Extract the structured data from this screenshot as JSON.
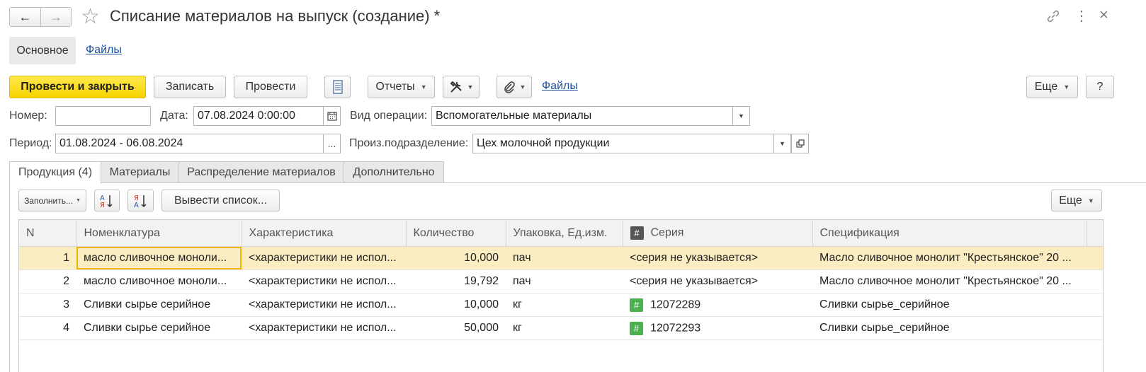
{
  "window": {
    "title": "Списание материалов на выпуск (создание) *",
    "back_icon": "←",
    "forward_icon": "→",
    "star_icon": "☆",
    "link_icon": "🔗",
    "menu_icon": "⋮",
    "close_icon": "×"
  },
  "nav_tabs": {
    "main": "Основное",
    "files": "Файлы"
  },
  "toolbar": {
    "post_close": "Провести и закрыть",
    "save": "Записать",
    "post": "Провести",
    "reports": "Отчеты",
    "files": "Файлы",
    "more": "Еще",
    "help": "?"
  },
  "form": {
    "number_label": "Номер:",
    "number_value": "",
    "date_label": "Дата:",
    "date_value": "07.08.2024  0:00:00",
    "operation_label": "Вид операции:",
    "operation_value": "Вспомогательные материалы",
    "period_label": "Период:",
    "period_value": "01.08.2024 - 06.08.2024",
    "period_btn": "...",
    "division_label": "Произ.подразделение:",
    "division_value": "Цех молочной продукции"
  },
  "tabs": [
    "Продукция (4)",
    "Материалы",
    "Распределение материалов",
    "Дополнительно"
  ],
  "table_toolbar": {
    "fill": "Заполнить...",
    "show_list": "Вывести список...",
    "more": "Еще",
    "sort_asc_glyph": "А\nЯ",
    "sort_desc_glyph": "Я\nА"
  },
  "table": {
    "columns": [
      "N",
      "Номенклатура",
      "Характеристика",
      "Количество",
      "Упаковка, Ед.изм.",
      "Серия",
      "Спецификация"
    ],
    "rows": [
      {
        "n": "1",
        "item": "масло сливочное моноли...",
        "char": "<характеристики не испол...",
        "qty": "10,000",
        "unit": "пач",
        "series": "<серия не указывается>",
        "series_muted": true,
        "spec": "Масло сливочное монолит \"Крестьянское\" 20 ..."
      },
      {
        "n": "2",
        "item": "масло сливочное моноли...",
        "char": "<характеристики не испол...",
        "qty": "19,792",
        "unit": "пач",
        "series": "<серия не указывается>",
        "series_muted": true,
        "spec": "Масло сливочное монолит \"Крестьянское\" 20 ..."
      },
      {
        "n": "3",
        "item": "Сливки сырье серийное",
        "char": "<характеристики не испол...",
        "qty": "10,000",
        "unit": "кг",
        "series": "12072289",
        "series_muted": false,
        "spec": "Сливки сырье_серийное"
      },
      {
        "n": "4",
        "item": "Сливки сырье серийное",
        "char": "<характеристики не испол...",
        "qty": "50,000",
        "unit": "кг",
        "series": "12072293",
        "series_muted": false,
        "spec": "Сливки сырье_серийное"
      }
    ]
  },
  "colors": {
    "accent_yellow": "#f7d300",
    "selected_row": "#fbedc2",
    "series_icon": "#4caf50",
    "link": "#1c4fa0"
  }
}
